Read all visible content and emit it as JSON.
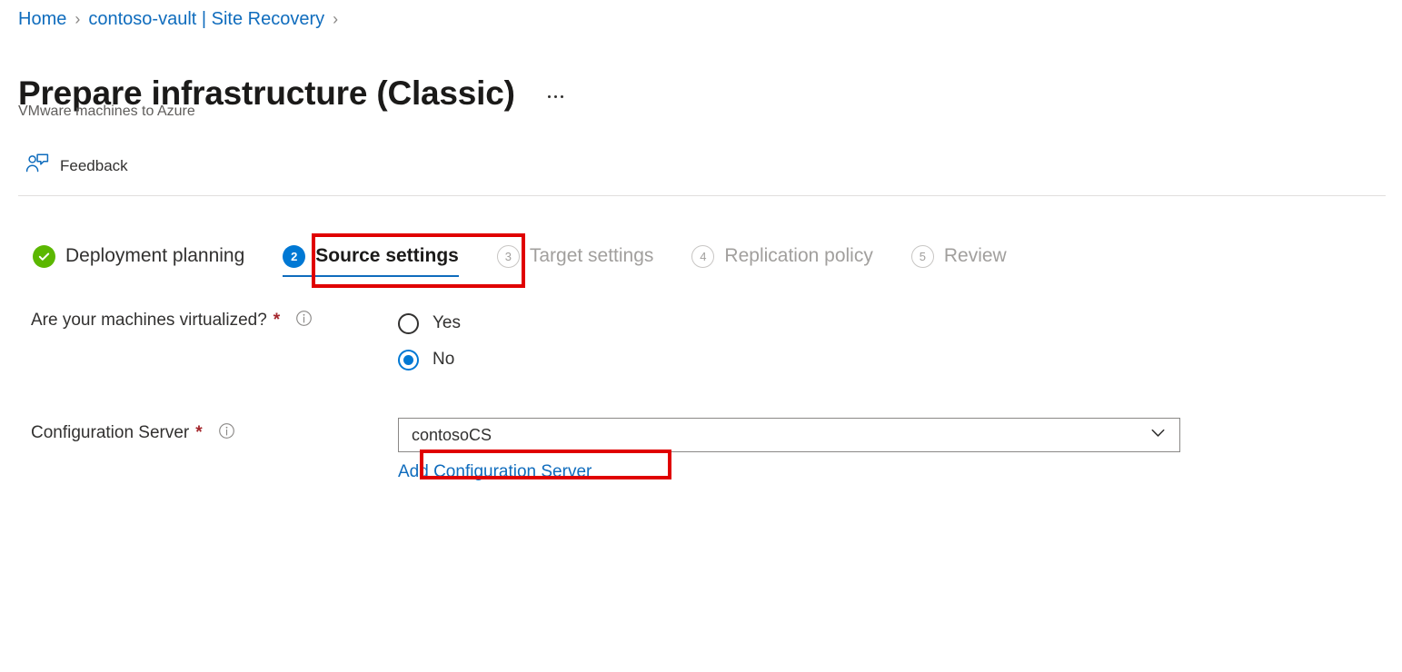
{
  "breadcrumb": {
    "items": [
      {
        "label": "Home",
        "icon": ""
      },
      {
        "label": "contoso-vault | Site Recovery",
        "icon": ""
      }
    ],
    "separator": "›"
  },
  "header": {
    "title": "Prepare infrastructure (Classic)",
    "subtitle": "VMware machines to Azure",
    "more_icon": "ellipsis-icon"
  },
  "commandbar": {
    "feedback": {
      "label": "Feedback",
      "icon": "feedback-person-comment-icon"
    }
  },
  "wizard": {
    "steps": [
      {
        "badge": "✓",
        "label": "Deployment planning",
        "state": "done"
      },
      {
        "badge": "2",
        "label": "Source settings",
        "state": "active"
      },
      {
        "badge": "3",
        "label": "Target settings",
        "state": "pending"
      },
      {
        "badge": "4",
        "label": "Replication policy",
        "state": "pending"
      },
      {
        "badge": "5",
        "label": "Review",
        "state": "pending"
      }
    ]
  },
  "form": {
    "virtualized": {
      "label": "Are your machines virtualized?",
      "required_marker": "*",
      "info_icon": "info-icon",
      "options": [
        {
          "label": "Yes",
          "checked": false
        },
        {
          "label": "No",
          "checked": true
        }
      ]
    },
    "configuration_server": {
      "label": "Configuration Server",
      "required_marker": "*",
      "info_icon": "info-icon",
      "selected_value": "contosoCS",
      "chevron_icon": "chevron-down-icon",
      "add_link": "Add Configuration Server"
    }
  },
  "highlights": {
    "color": "#e00000",
    "targets": [
      "source-settings-step",
      "add-configuration-server-link"
    ]
  },
  "colors": {
    "link": "#0f6cbd",
    "accent": "#0078d4",
    "success": "#5bb700",
    "required": "#a4262c",
    "text": "#323130",
    "muted": "#a19f9d",
    "border": "#8a8886",
    "divider": "#e1dfdd"
  }
}
